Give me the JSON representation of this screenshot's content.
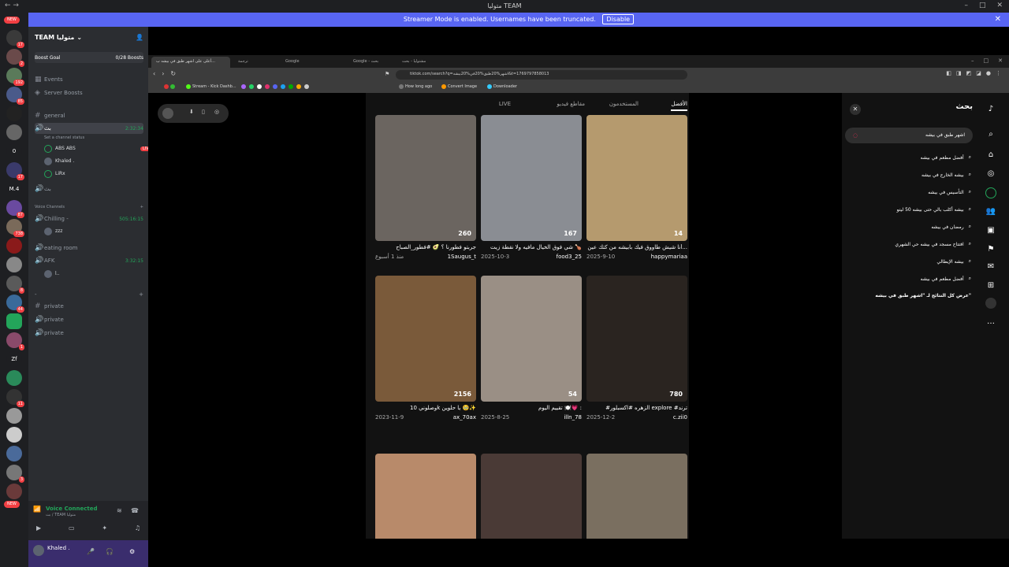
{
  "window": {
    "title": "متوليا TEAM",
    "banner": "Streamer Mode is enabled. Usernames have been truncated.",
    "banner_btn": "Disable"
  },
  "servers": {
    "top_new": "NEW",
    "bottom_new": "NEW",
    "letters": [
      "0",
      "M.4",
      "Zf"
    ],
    "badges": [
      "17",
      "2",
      "192",
      "85",
      "17",
      "87",
      "738",
      "8",
      "44",
      "1",
      "11",
      "3"
    ]
  },
  "server": {
    "name": "TEAM متوليا",
    "boost_goal": "Boost Goal",
    "boosts": "0/28 Boosts",
    "events": "Events",
    "server_boosts": "Server Boosts"
  },
  "channels": {
    "general": "general",
    "active_voice": "بث",
    "active_time": "2:32:34",
    "status": "Set a channel status",
    "users": [
      {
        "name": "ABS ABS",
        "live": "LIVE"
      },
      {
        "name": "Khaled ."
      },
      {
        "name": "LiRx"
      }
    ],
    "voice2": "بث",
    "voice_header": "Voice Channels",
    "chilling": "Chilling -",
    "chilling_time": "505:16:15",
    "chilling_user": "zzz",
    "eating": "eating room",
    "afk": "AFK",
    "afk_time": "3:32:15",
    "afk_user": "l..",
    "dash": "-",
    "private": [
      "private",
      "private",
      "private"
    ]
  },
  "voice": {
    "connected": "Voice Connected",
    "sub": "بث / TEAM متوليا"
  },
  "user": {
    "name": "Khaled ."
  },
  "browser": {
    "tabs": [
      "أعلى على اشهر طبق في بيشه ب...",
      "ترجمة",
      "Google",
      "Google - بحث",
      "مشتوليا - بحث"
    ],
    "url": "tiktok.com/search?q=اشهر%20طبق%20في%20بيشه&t=1769797858013",
    "bookmarks": [
      "Stream - Kick Dashb...",
      "How long ago",
      "Convert Image",
      "Downloader"
    ]
  },
  "tiktok": {
    "tabs": [
      "الأفضل",
      "المستخدمون",
      "مقاطع فيديو",
      "LIVE"
    ],
    "search_title": "بحث",
    "query": "اشهر طبق في بيشه",
    "suggestions": [
      "أفضل مطعم في بيشه",
      "بيشه الخارج في بيشه",
      "التأسيس في بيشه",
      "بيشه أكلب بالي حتى بيشه 50 ليتو",
      "رمضان في بيشه",
      "افتتاح مسجد في بيشه حي الشهري",
      "بيشه الإيطالي",
      "أفضل مطعم في بيشه"
    ],
    "view_all": "عرض كل النتائج لـ \"اشهر طبق في بيشه\"",
    "videos": [
      {
        "likes": "260",
        "caption": "جربتو فطورنا ؟ 🥑 #فطور_الصباح",
        "date": "منذ 1 أسبوع",
        "author": "1Saugus_t",
        "color": "#6b6560"
      },
      {
        "likes": "167",
        "caption": "شي فوق الخيال مافيه ولا نقطة زيت 🍗",
        "date": "2025-10-3",
        "author": "food3_25",
        "color": "#8a8d93"
      },
      {
        "likes": "14",
        "caption": "أنا شيش طاووق فيك بابيشه من كتك عين...",
        "date": "2025-9-10",
        "author": "happymariaa",
        "color": "#b59a6e"
      },
      {
        "likes": "2156",
        "caption": "وصلوني 10k يا حلوين 🥹✨",
        "date": "2023-11-9",
        "author": "ax_70ax",
        "color": "#7a5a3a"
      },
      {
        "likes": "54",
        "caption": "تقييم اليوم 🍽️💗 :",
        "date": "2025-8-25",
        "author": "illn_78",
        "color": "#9a8f85"
      },
      {
        "likes": "780",
        "caption": "#الزهره #اكسبلور explore #ترند",
        "date": "2025-12-2",
        "author": "c.zii0",
        "color": "#2a2420"
      },
      {
        "likes": "",
        "caption": "",
        "date": "",
        "author": "",
        "color": "#b88a6a"
      },
      {
        "likes": "",
        "caption": "",
        "date": "",
        "author": "",
        "color": "#4a3a36"
      },
      {
        "likes": "",
        "caption": "",
        "date": "",
        "author": "",
        "color": "#7a6f60"
      }
    ]
  }
}
